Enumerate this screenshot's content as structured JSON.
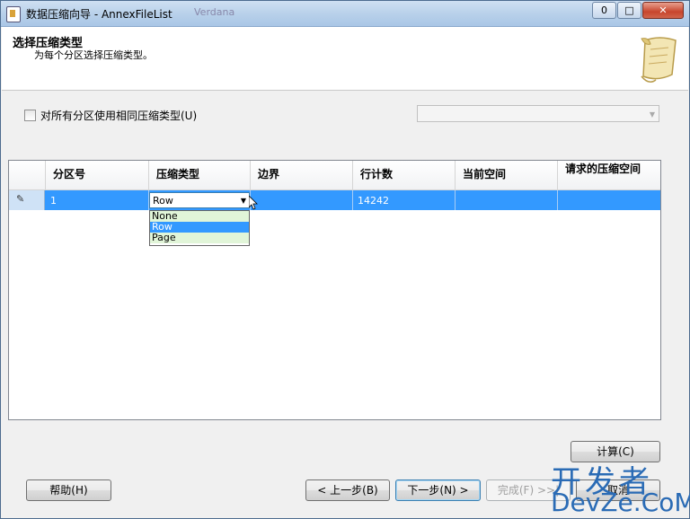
{
  "window": {
    "title": "数据压缩向导 - AnnexFileList",
    "background_text": "Verdana",
    "minimize": "0",
    "maximize": "□",
    "close": "✕"
  },
  "header": {
    "title": "选择压缩类型",
    "subtitle": "为每个分区选择压缩类型。"
  },
  "options": {
    "same_type_label": "对所有分区使用相同压缩类型(U)",
    "same_type_checked": false
  },
  "grid": {
    "columns": [
      "分区号",
      "压缩类型",
      "边界",
      "行计数",
      "当前空间",
      "请求的压缩空间"
    ],
    "rows": [
      {
        "partition": "1",
        "compression": "Row",
        "boundary": "",
        "row_count": "14242",
        "current_space": "",
        "requested_space": ""
      }
    ],
    "dropdown_options": [
      "None",
      "Row",
      "Page"
    ],
    "dropdown_selected": "Row",
    "row_header_icon": "pencil-icon"
  },
  "buttons": {
    "calculate": "计算(C)",
    "help": "帮助(H)",
    "back": "< 上一步(B)",
    "next": "下一步(N) >",
    "finish": "完成(F) >>|",
    "cancel": "取消"
  },
  "watermark": {
    "line1": "开发者",
    "line2": "DevZe.CoM"
  },
  "colors": {
    "selection": "#3399ff",
    "watermark": "#2a6bb5"
  }
}
